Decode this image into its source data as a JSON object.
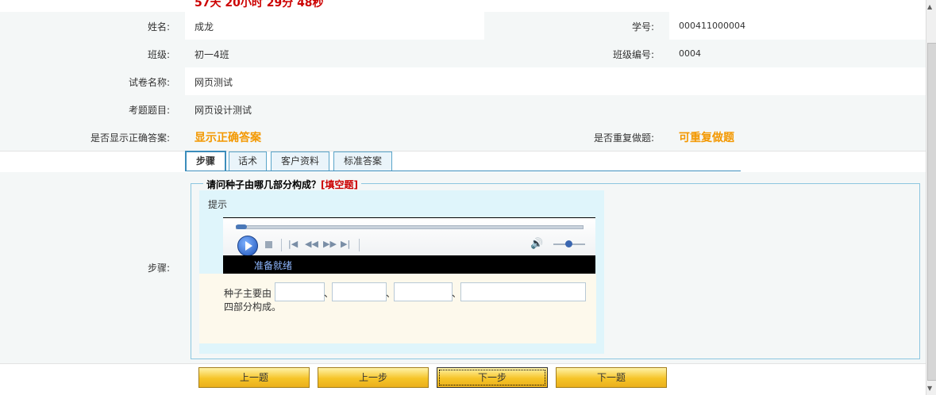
{
  "timer": {
    "text": "57天 20小时 29分 48秒"
  },
  "info": {
    "name_label": "姓名:",
    "name_value": "成龙",
    "id_label": "学号:",
    "id_value": "000411000004",
    "class_label": "班级:",
    "class_value": "初一4班",
    "class_no_label": "班级编号:",
    "class_no_value": "0004",
    "paper_label": "试卷名称:",
    "paper_value": "网页测试",
    "topic_label": "考题题目:",
    "topic_value": "网页设计测试",
    "show_answer_label": "是否显示正确答案:",
    "show_answer_value": "显示正确答案",
    "repeat_label": "是否重复做题:",
    "repeat_value": "可重复做题"
  },
  "tabs": [
    {
      "label": "步骤",
      "active": true
    },
    {
      "label": "话术",
      "active": false
    },
    {
      "label": "客户资料",
      "active": false
    },
    {
      "label": "标准答案",
      "active": false
    }
  ],
  "step": {
    "label": "步骤:",
    "question": "请问种子由哪几部分构成？",
    "question_type": "[填空题]",
    "hint": "提示",
    "player_status": "准备就绪",
    "sentence_start": "种子主要由",
    "separator": "、",
    "sentence_end": "四部分构成。"
  },
  "nav": {
    "prev_question": "上一题",
    "prev_step": "上一步",
    "next_step": "下一步",
    "next_question": "下一题"
  },
  "colors": {
    "accent_orange": "#f39800",
    "tab_border": "#3c8dbb",
    "button_gold": "#f6c428",
    "question_type_red": "#cc0000"
  },
  "icons": [
    "play-icon",
    "stop-icon",
    "skip-back-icon",
    "rewind-icon",
    "fast-forward-icon",
    "skip-forward-icon",
    "volume-icon"
  ]
}
